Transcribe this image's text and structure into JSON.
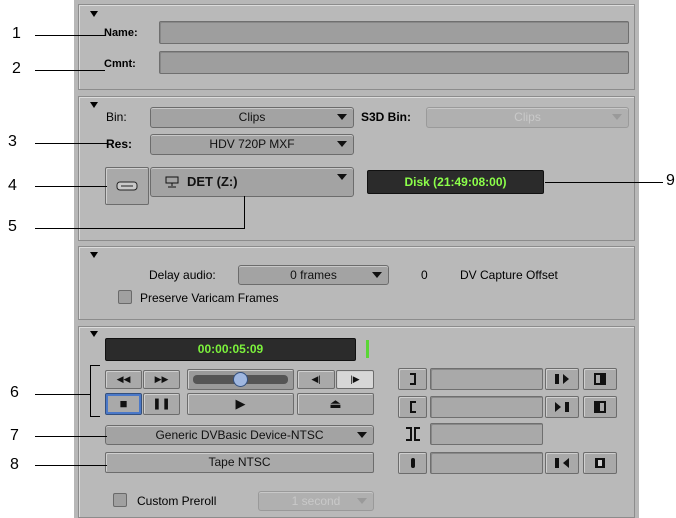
{
  "callouts": {
    "n1": "1",
    "n2": "2",
    "n3": "3",
    "n4": "4",
    "n5": "5",
    "n6": "6",
    "n7": "7",
    "n8": "8",
    "n9": "9"
  },
  "name_section": {
    "name_label": "Name:",
    "comment_label": "Cmnt:",
    "name_value": "",
    "comment_value": ""
  },
  "bin_section": {
    "bin_label": "Bin:",
    "bin_value": "Clips",
    "s3d_label": "S3D Bin:",
    "s3d_value": "Clips",
    "res_label": "Res:",
    "res_value": "HDV 720P  MXF",
    "target_drive": "DET (Z:)",
    "disk_status": "Disk (21:49:08:00)"
  },
  "audio_section": {
    "delay_label": "Delay audio:",
    "delay_value": "0 frames",
    "offset_value": "0",
    "offset_label": "DV Capture Offset",
    "varicam_label": "Preserve Varicam Frames"
  },
  "deck_section": {
    "timecode": "00:00:05:09",
    "device_value": "Generic DVBasic Device-NTSC",
    "tape_value": "Tape  NTSC",
    "preroll_label": "Custom Preroll",
    "preroll_value": "1 second"
  },
  "icons": {
    "rewind": "◀◀",
    "fast_forward": "▶▶",
    "step_back": "◀|",
    "step_forward": "|▶",
    "stop": "■",
    "pause": "❚❚",
    "play": "▶",
    "eject": "⏏"
  },
  "colors": {
    "panel_bg": "#b9b9b9",
    "disk_text": "#8cff4a",
    "timecode_text": "#7cf23c",
    "stop_highlight": "#4a78c8"
  }
}
